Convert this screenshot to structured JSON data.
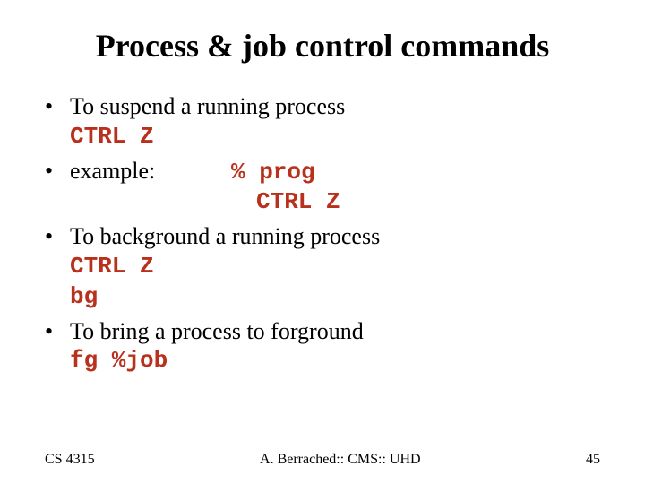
{
  "title": "Process & job control commands",
  "bullets": {
    "b1": "To suspend a running process",
    "b1_cmd": "CTRL Z",
    "b2_label": "example:",
    "b2_cmd1": "% prog",
    "b2_cmd2": "CTRL Z",
    "b3": "To background a running process",
    "b3_cmd1": "CTRL Z",
    "b3_cmd2": "bg",
    "b4": "To bring a process to forground",
    "b4_cmd": "fg  %job"
  },
  "footer": {
    "left": "CS 4315",
    "center": "A. Berrached:: CMS:: UHD",
    "right": "45"
  }
}
